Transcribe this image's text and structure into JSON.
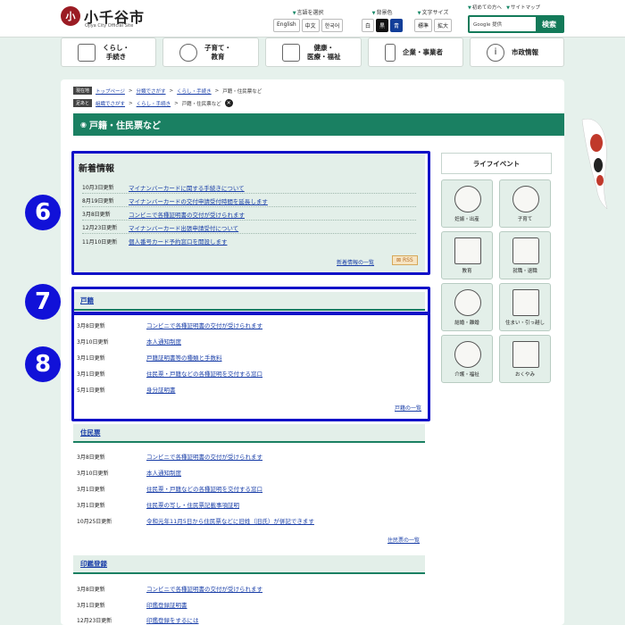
{
  "header": {
    "logo_glyph": "小",
    "title": "小千谷市",
    "subtitle": "Ojiya City Official Site",
    "language": {
      "label": "言語を選択",
      "options": [
        "English",
        "中文",
        "한국어"
      ]
    },
    "background": {
      "label": "背景色",
      "options": [
        "白",
        "黒",
        "青"
      ]
    },
    "fontsize": {
      "label": "文字サイズ",
      "options": [
        "標準",
        "拡大"
      ]
    },
    "toplinks": [
      "初めての方へ",
      "サイトマップ"
    ],
    "search": {
      "placeholder": "Google 提供",
      "button": "検索"
    }
  },
  "nav": [
    {
      "label": "くらし・\n手続き",
      "icon": "document-icon"
    },
    {
      "label": "子育て・\n教育",
      "icon": "family-icon"
    },
    {
      "label": "健康・\n医療・福祉",
      "icon": "hospital-icon"
    },
    {
      "label": "企業・事業者",
      "icon": "phone-icon"
    },
    {
      "label": "市政情報",
      "icon": "info-icon"
    }
  ],
  "breadcrumb": {
    "tag": "現在地",
    "items": [
      "トップページ",
      "分類でさがす",
      "くらし・手続き"
    ],
    "current": "戸籍・住民票など"
  },
  "footprint": {
    "tag": "足あと",
    "items": [
      "組織でさがす",
      "くらし・手続き"
    ],
    "current": "戸籍・住民票など"
  },
  "page_title": "戸籍・住民票など",
  "news": {
    "title": "新着情報",
    "items": [
      {
        "date": "10月3日更新",
        "text": "マイナンバーカードに関する手続きについて"
      },
      {
        "date": "8月19日更新",
        "text": "マイナンバーカードの交付申請受付時間を延長します"
      },
      {
        "date": "3月8日更新",
        "text": "コンビニで各種証明書の交付が受けられます"
      },
      {
        "date": "12月23日更新",
        "text": "マイナンバーカード出張申請受付について"
      },
      {
        "date": "11月10日更新",
        "text": "個人番号カード予約窓口を開設します"
      }
    ],
    "more": "新着情報の一覧",
    "rss": "RSS"
  },
  "sections": [
    {
      "title": "戸籍",
      "items": [
        {
          "date": "3月8日更新",
          "text": "コンビニで各種証明書の交付が受けられます"
        },
        {
          "date": "3月10日更新",
          "text": "本人通知制度"
        },
        {
          "date": "3月1日更新",
          "text": "戸籍証明書等の種類と手数料"
        },
        {
          "date": "3月1日更新",
          "text": "住民票・戸籍などの各種証明を交付する窓口"
        },
        {
          "date": "5月1日更新",
          "text": "身分証明書"
        }
      ],
      "more": "戸籍の一覧"
    },
    {
      "title": "住民票",
      "items": [
        {
          "date": "3月8日更新",
          "text": "コンビニで各種証明書の交付が受けられます"
        },
        {
          "date": "3月10日更新",
          "text": "本人通知制度"
        },
        {
          "date": "3月1日更新",
          "text": "住民票・戸籍などの各種証明を交付する窓口"
        },
        {
          "date": "3月1日更新",
          "text": "住民票の写し・住民票記載事項証明"
        },
        {
          "date": "10月25日更新",
          "text": "令和元年11月5日から住民票などに旧姓（旧氏）が併記できます"
        }
      ],
      "more": "住民票の一覧"
    },
    {
      "title": "印鑑登録",
      "items": [
        {
          "date": "3月8日更新",
          "text": "コンビニで各種証明書の交付が受けられます"
        },
        {
          "date": "3月1日更新",
          "text": "印鑑登録証明書"
        },
        {
          "date": "12月23日更新",
          "text": "印鑑登録をするには"
        }
      ]
    }
  ],
  "life_events": {
    "title": "ライフイベント",
    "items": [
      {
        "label": "妊娠・出産",
        "icon": "baby-icon"
      },
      {
        "label": "子育て",
        "icon": "child-icon"
      },
      {
        "label": "教育",
        "icon": "school-icon"
      },
      {
        "label": "就職・退職",
        "icon": "bag-icon"
      },
      {
        "label": "結婚・離婚",
        "icon": "rings-icon"
      },
      {
        "label": "住まい・引っ越し",
        "icon": "house-icon"
      },
      {
        "label": "介護・福祉",
        "icon": "wheelchair-icon"
      },
      {
        "label": "おくやみ",
        "icon": "portrait-icon"
      }
    ]
  },
  "markers": [
    "6",
    "7",
    "8"
  ],
  "colors": {
    "accent": "#1a8062",
    "highlight": "#1111c8",
    "link": "#1a3fa8"
  }
}
